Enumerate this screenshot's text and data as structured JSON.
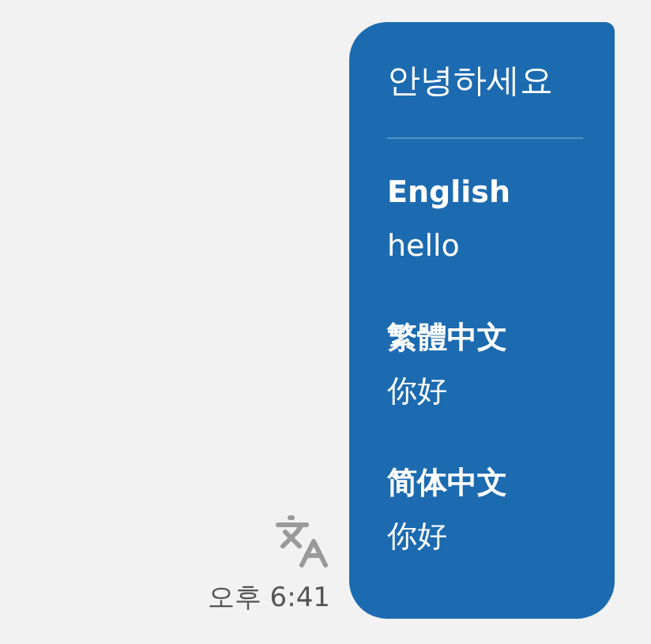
{
  "message": {
    "original": "안녕하세요",
    "translations": [
      {
        "language": "English",
        "text": "hello"
      },
      {
        "language": "繁體中文",
        "text": "你好"
      },
      {
        "language": "简体中文",
        "text": "你好"
      }
    ]
  },
  "time": "오후 6:41"
}
